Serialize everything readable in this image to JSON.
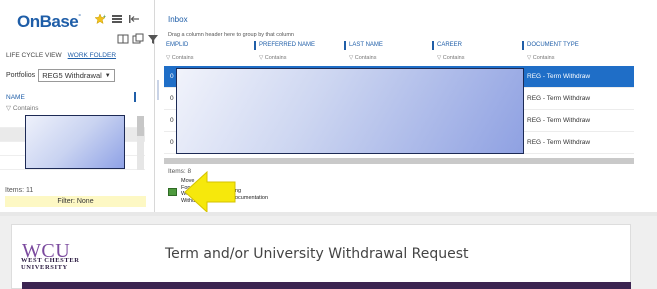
{
  "left_panel": {
    "brand": "OnBase",
    "tabs": [
      "LIFE CYCLE VIEW",
      "WORK FOLDER"
    ],
    "portfolio_label": "Portfolios",
    "portfolio_value": "REG5 Withdrawal",
    "name_header": "NAME",
    "filter_hint": "Contains",
    "items_text": "Items: 11",
    "filter_text": "Filter: None"
  },
  "inbox": {
    "title": "Inbox",
    "group_hint": "Drag a column header here to group by that column",
    "filter_hint": "Contains",
    "columns": [
      "EMPLID",
      "PREFERRED NAME",
      "LAST NAME",
      "CAREER",
      "DOCUMENT TYPE"
    ],
    "rows": [
      {
        "first_cell": "0",
        "document_type": "REG - Term Withdraw",
        "selected": true
      },
      {
        "first_cell": "0",
        "document_type": "REG - Term Withdraw",
        "selected": false
      },
      {
        "first_cell": "0",
        "document_type": "REG - Term Withdraw",
        "selected": false
      },
      {
        "first_cell": "0",
        "document_type": "REG - Term Withdraw",
        "selected": false
      }
    ],
    "items_text": "Items: 8",
    "task": {
      "line1": "Move",
      "line2": "Forward",
      "line3": "With",
      "line4": "Withdraw",
      "line5": "ng",
      "line6": "ocumentation"
    }
  },
  "form": {
    "logo": "WCU",
    "logo_sub1": "WEST CHESTER",
    "logo_sub2": "UNIVERSITY",
    "title": "Term and/or University Withdrawal Request"
  },
  "colors": {
    "brand_blue": "#1f5ea8",
    "selected_row": "#1f6ec7",
    "filter_bg": "#fdf8c4",
    "wcu_purple": "#7b4a9e",
    "band_purple": "#3b2451",
    "arrow_yellow": "#f6e80c"
  }
}
